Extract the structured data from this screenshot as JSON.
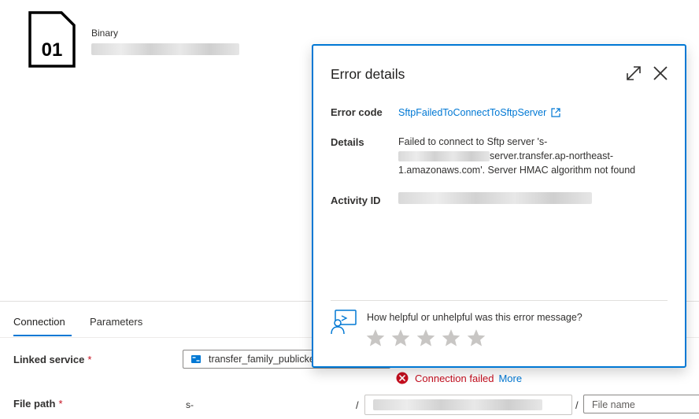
{
  "dataset": {
    "type_label": "Binary",
    "icon_text": "01"
  },
  "tabs": [
    {
      "label": "Connection",
      "active": true
    },
    {
      "label": "Parameters",
      "active": false
    }
  ],
  "linked_service": {
    "label": "Linked service",
    "required_mark": "*",
    "value": "transfer_family_publickey"
  },
  "connection_status": {
    "text": "Connection failed",
    "more": "More",
    "color": "#c50f1f"
  },
  "file_path": {
    "label": "File path",
    "required_mark": "*",
    "prefix": "s-",
    "separator": "/",
    "file_name_placeholder": "File name"
  },
  "error_panel": {
    "title": "Error details",
    "error_code_label": "Error code",
    "error_code_value": "SftpFailedToConnectToSftpServer",
    "details_label": "Details",
    "details_line1": "Failed to connect to Sftp server 's-",
    "details_line2_suffix": "server.transfer.ap-northeast-",
    "details_line3": "1.amazonaws.com'. Server HMAC algorithm not found",
    "activity_id_label": "Activity ID",
    "feedback_question": "How helpful or unhelpful was this error message?",
    "stars": 5,
    "icons": {
      "expand": "expand-icon",
      "close": "close-icon",
      "external_link": "external-link-icon",
      "feedback": "feedback-icon",
      "star": "star-icon"
    }
  },
  "colors": {
    "accent": "#0078d4",
    "error": "#c50f1f",
    "star_empty": "#c8c6c4"
  }
}
